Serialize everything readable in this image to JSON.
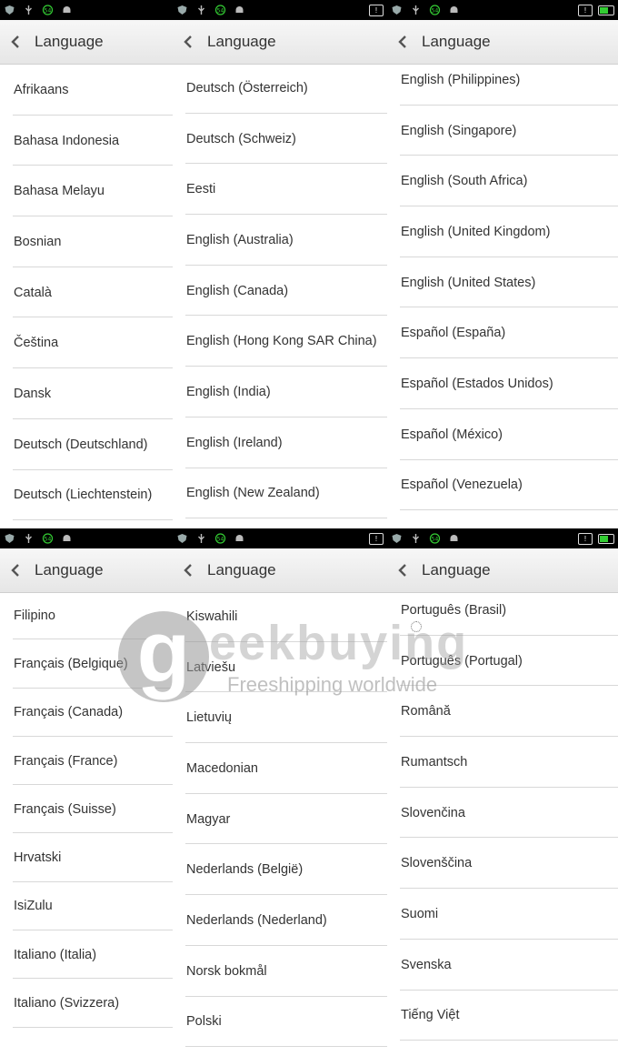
{
  "status_bar": {
    "battery_label": "54"
  },
  "header": {
    "title": "Language"
  },
  "panels": [
    {
      "items": [
        "Afrikaans",
        "Bahasa Indonesia",
        "Bahasa Melayu",
        "Bosnian",
        "Català",
        "Čeština",
        "Dansk",
        "Deutsch (Deutschland)",
        "Deutsch (Liechtenstein)"
      ]
    },
    {
      "items": [
        "Deutsch (Österreich)",
        "Deutsch (Schweiz)",
        "Eesti",
        "English (Australia)",
        "English (Canada)",
        "English (Hong Kong SAR China)",
        "English (India)",
        "English (Ireland)",
        "English (New Zealand)"
      ]
    },
    {
      "items": [
        "English (Philippines)",
        "English (Singapore)",
        "English (South Africa)",
        "English (United Kingdom)",
        "English (United States)",
        "Español (España)",
        "Español (Estados Unidos)",
        "Español (México)",
        "Español (Venezuela)"
      ]
    },
    {
      "items": [
        "Filipino",
        "Français (Belgique)",
        "Français (Canada)",
        "Français (France)",
        "Français (Suisse)",
        "Hrvatski",
        "IsiZulu",
        "Italiano (Italia)",
        "Italiano (Svizzera)"
      ]
    },
    {
      "items": [
        "Kiswahili",
        "Latviešu",
        "Lietuvių",
        "Macedonian",
        "Magyar",
        "Nederlands (België)",
        "Nederlands (Nederland)",
        "Norsk bokmål",
        "Polski"
      ]
    },
    {
      "items": [
        "Português (Brasil)",
        "Português (Portugal)",
        "Română",
        "Rumantsch",
        "Slovenčina",
        "Slovenščina",
        "Suomi",
        "Svenska",
        "Tiếng Việt"
      ]
    }
  ],
  "watermark": {
    "logo_letter": "g",
    "brand": "eekbuying",
    "tagline": "Freeshipping worldwide"
  }
}
